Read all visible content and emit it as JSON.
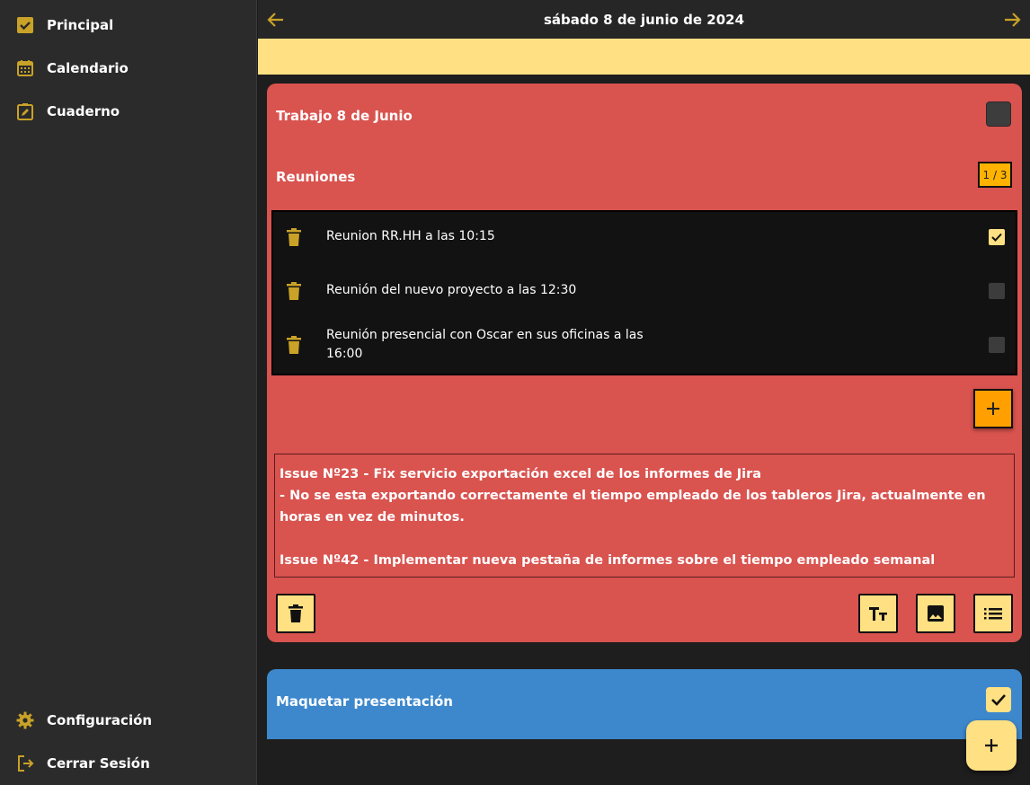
{
  "sidebar": {
    "items": [
      {
        "label": "Principal",
        "icon": "checkbox-icon"
      },
      {
        "label": "Calendario",
        "icon": "calendar-icon"
      },
      {
        "label": "Cuaderno",
        "icon": "edit-note-icon"
      }
    ],
    "bottom_items": [
      {
        "label": "Configuración",
        "icon": "gear-icon"
      },
      {
        "label": "Cerrar Sesión",
        "icon": "logout-icon"
      }
    ]
  },
  "header": {
    "date": "sábado 8 de junio de 2024"
  },
  "colors": {
    "accent": "#ffe082",
    "accent_strong": "#ffa000",
    "icon_gold": "#c9a227",
    "card_red": "#d9534f",
    "card_blue": "#3d88cc",
    "sidebar_bg": "#2b2b2b"
  },
  "card_work": {
    "title": "Trabajo 8 de Junio",
    "done": false,
    "checklist_title": "Reuniones",
    "counter": "1 / 3",
    "items": [
      {
        "text": "Reunion RR.HH a las 10:15",
        "checked": true
      },
      {
        "text": "Reunión del nuevo proyecto a las 12:30",
        "checked": false
      },
      {
        "text": "Reunión presencial con Oscar en sus oficinas a las 16:00",
        "checked": false
      }
    ],
    "note": {
      "lines": [
        "Issue Nº23 - Fix servicio exportación excel de los informes de Jira",
        "- No se esta exportando correctamente el tiempo empleado de los tableros Jira, actualmente en horas en vez de minutos.",
        "",
        "Issue Nº42 - Implementar nueva pestaña de informes sobre el tiempo empleado semanal"
      ]
    }
  },
  "card_layout": {
    "title": "Maquetar presentación",
    "done": true
  }
}
